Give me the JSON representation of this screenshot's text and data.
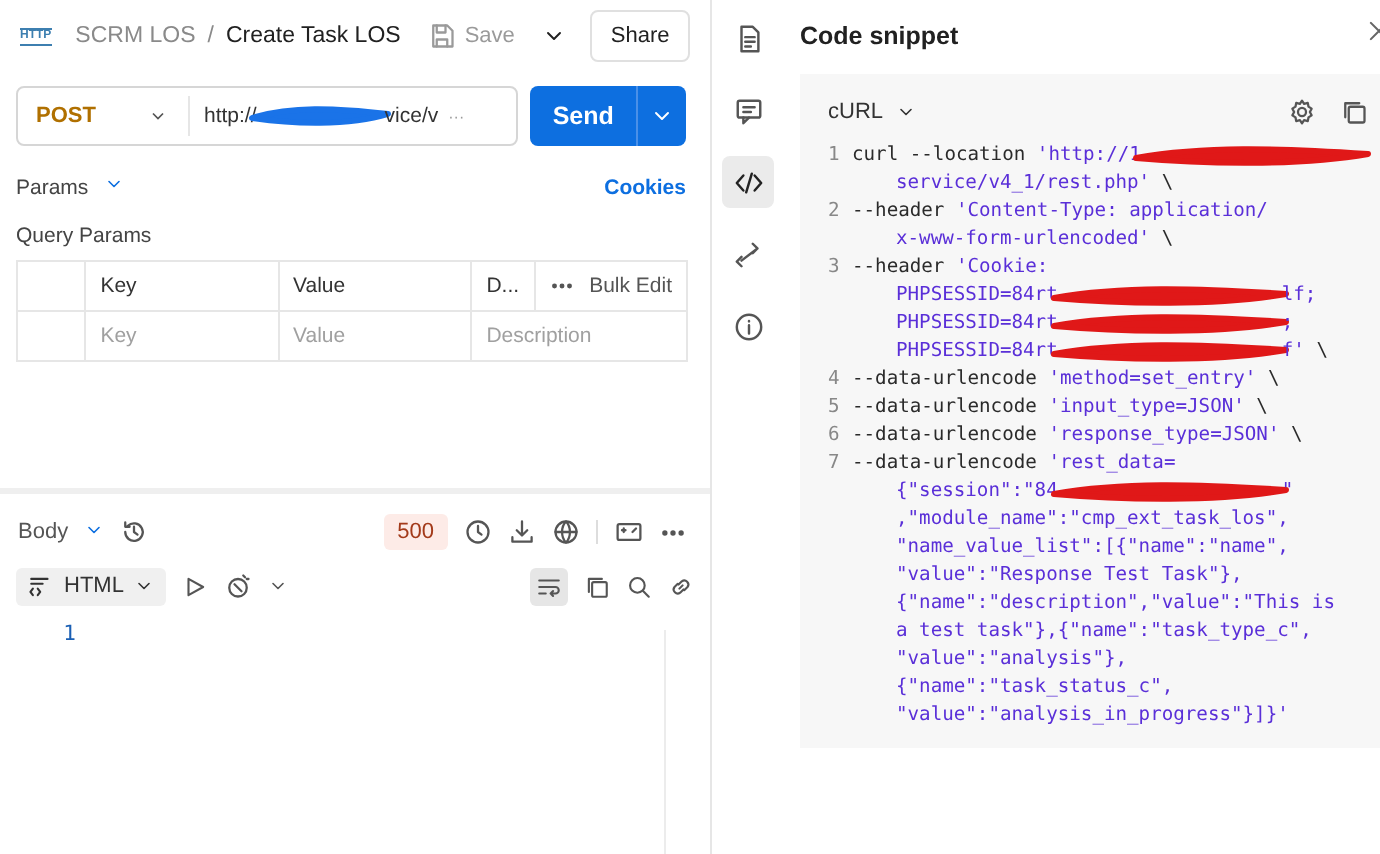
{
  "header": {
    "app_badge": "HTTP",
    "breadcrumb": [
      "SCRM LOS",
      "Create Task LOS"
    ],
    "separator": "/",
    "save": {
      "label": "Save",
      "disabled": true
    },
    "share": "Share"
  },
  "request": {
    "method": "POST",
    "url": [
      {
        "kind": "text",
        "text": "http://"
      },
      {
        "kind": "redaction"
      },
      {
        "kind": "text",
        "text": "vice/v"
      }
    ],
    "url_overflow": "···",
    "send": "Send"
  },
  "params": {
    "label": "Params",
    "cookies": "Cookies",
    "query_title": "Query Params",
    "columns": [
      "Key",
      "Value",
      "D..."
    ],
    "bulk_edit": "Bulk Edit",
    "placeholders": [
      "Key",
      "Value",
      "Description"
    ]
  },
  "response": {
    "tab": "Body",
    "status": "500",
    "format": "HTML",
    "wrap_on": true,
    "line_numbers": [
      "1"
    ]
  },
  "sidebar": [
    {
      "kind": "document",
      "selected": false
    },
    {
      "kind": "comment",
      "selected": false
    },
    {
      "kind": "code",
      "selected": true
    },
    {
      "kind": "arrows",
      "selected": false
    },
    {
      "kind": "info",
      "selected": false
    }
  ],
  "snippet": {
    "title": "Code snippet",
    "language": "cURL",
    "rows": [
      {
        "number": "1",
        "segments": [
          {
            "kind": "plain",
            "text": "curl --location "
          },
          {
            "kind": "string",
            "text": "'http://1"
          },
          {
            "kind": "redaction"
          }
        ]
      },
      {
        "segments": [
          {
            "kind": "string",
            "text": "service/v4_1/rest.php'"
          },
          {
            "kind": "plain",
            "text": " \\"
          }
        ]
      },
      {
        "number": "2",
        "segments": [
          {
            "kind": "plain",
            "text": "--header "
          },
          {
            "kind": "string",
            "text": "'Content-Type: application/"
          }
        ]
      },
      {
        "segments": [
          {
            "kind": "string",
            "text": "x-www-form-urlencoded'"
          },
          {
            "kind": "plain",
            "text": " \\"
          }
        ]
      },
      {
        "number": "3",
        "segments": [
          {
            "kind": "plain",
            "text": "--header "
          },
          {
            "kind": "string",
            "text": "'Cookie:"
          }
        ]
      },
      {
        "segments": [
          {
            "kind": "string",
            "text": "PHPSESSID=84rt"
          },
          {
            "kind": "redaction"
          },
          {
            "kind": "string",
            "text": "lf;"
          }
        ]
      },
      {
        "segments": [
          {
            "kind": "string",
            "text": "PHPSESSID=84rt"
          },
          {
            "kind": "redaction"
          },
          {
            "kind": "string",
            "text": ";"
          }
        ]
      },
      {
        "segments": [
          {
            "kind": "string",
            "text": "PHPSESSID=84rt"
          },
          {
            "kind": "redaction"
          },
          {
            "kind": "string",
            "text": "f'"
          },
          {
            "kind": "plain",
            "text": " \\"
          }
        ]
      },
      {
        "number": "4",
        "segments": [
          {
            "kind": "plain",
            "text": "--data-urlencode "
          },
          {
            "kind": "string",
            "text": "'method=set_entry'"
          },
          {
            "kind": "plain",
            "text": " \\"
          }
        ]
      },
      {
        "number": "5",
        "segments": [
          {
            "kind": "plain",
            "text": "--data-urlencode "
          },
          {
            "kind": "string",
            "text": "'input_type=JSON'"
          },
          {
            "kind": "plain",
            "text": " \\"
          }
        ]
      },
      {
        "number": "6",
        "segments": [
          {
            "kind": "plain",
            "text": "--data-urlencode "
          },
          {
            "kind": "string",
            "text": "'response_type=JSON'"
          },
          {
            "kind": "plain",
            "text": " \\"
          }
        ]
      },
      {
        "number": "7",
        "segments": [
          {
            "kind": "plain",
            "text": "--data-urlencode "
          },
          {
            "kind": "string",
            "text": "'rest_data="
          }
        ]
      },
      {
        "segments": [
          {
            "kind": "string",
            "text": "{\"session\":\"84"
          },
          {
            "kind": "redaction"
          },
          {
            "kind": "string",
            "text": "\""
          }
        ]
      },
      {
        "segments": [
          {
            "kind": "string",
            "text": ",\"module_name\":\"cmp_ext_task_los\","
          }
        ]
      },
      {
        "segments": [
          {
            "kind": "string",
            "text": "\"name_value_list\":[{\"name\":\"name\","
          }
        ]
      },
      {
        "segments": [
          {
            "kind": "string",
            "text": "\"value\":\"Response Test Task\"},"
          }
        ]
      },
      {
        "segments": [
          {
            "kind": "string",
            "text": "{\"name\":\"description\",\"value\":\"This is"
          }
        ]
      },
      {
        "segments": [
          {
            "kind": "string",
            "text": "a test task\"},{\"name\":\"task_type_c\","
          }
        ]
      },
      {
        "segments": [
          {
            "kind": "string",
            "text": "\"value\":\"analysis\"},"
          }
        ]
      },
      {
        "segments": [
          {
            "kind": "string",
            "text": "{\"name\":\"task_status_c\","
          }
        ]
      },
      {
        "segments": [
          {
            "kind": "string",
            "text": "\"value\":\"analysis_in_progress\"}]}'"
          }
        ]
      }
    ]
  }
}
